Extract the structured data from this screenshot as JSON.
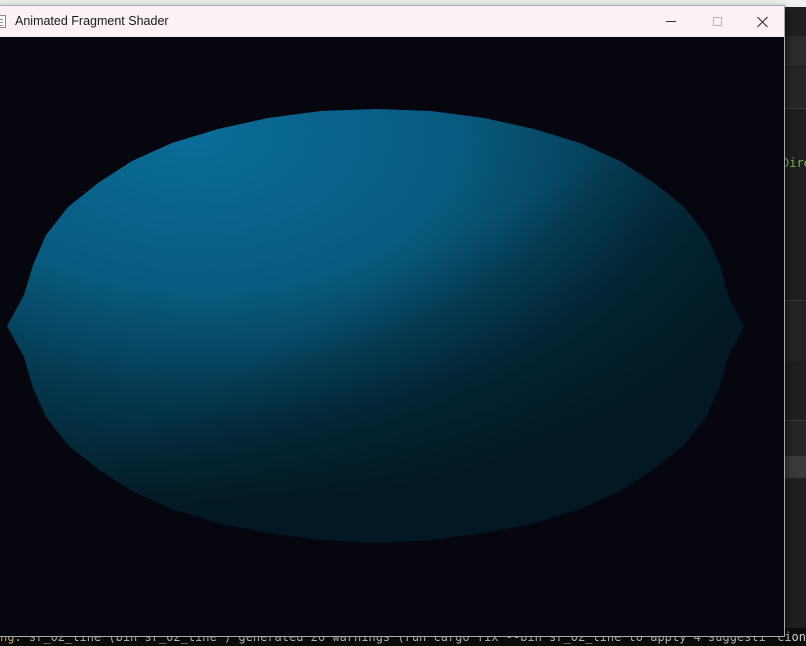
{
  "window": {
    "title": "Animated Fragment Shader",
    "controls": {
      "minimize": "minimize-icon",
      "maximize": "maximize-icon",
      "close": "close-icon"
    }
  },
  "viewport": {
    "background_color": "#06060f",
    "shape": "shaded-ellipse",
    "shape_color_light": "#0a6e9a",
    "shape_color_dark": "#03202c"
  },
  "background_terminal": {
    "right_text": "Dire",
    "bottom_prefix": "ng:",
    "bottom_line": " sr_02_line  (bin  sr_02_line ) generated 26 warnings (run  cargo fix --bin  sr_02_line   to apply 4 suggesti",
    "bottom_tail": "cion"
  }
}
